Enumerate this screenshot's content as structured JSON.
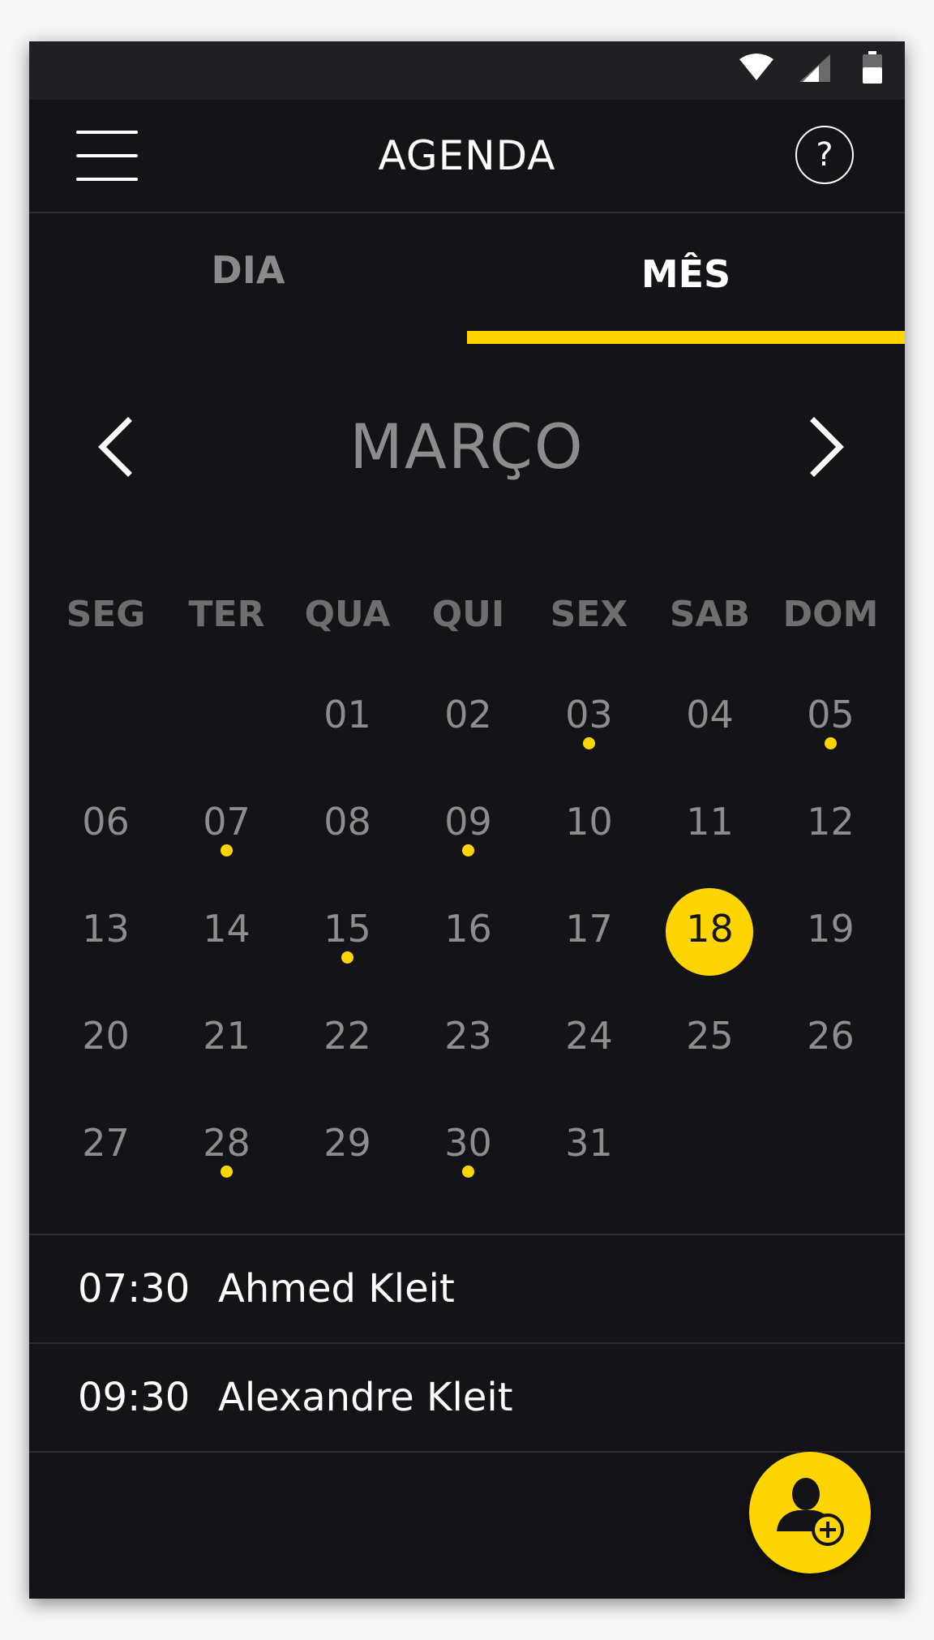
{
  "status_bar": {
    "icons": [
      "wifi-icon",
      "cell-signal-icon",
      "battery-icon"
    ]
  },
  "app_bar": {
    "title": "AGENDA",
    "menu_icon": "hamburger-menu-icon",
    "help_label": "?"
  },
  "tabs": [
    {
      "label": "DIA",
      "active": false
    },
    {
      "label": "MÊS",
      "active": true
    }
  ],
  "calendar": {
    "month": "MARÇO",
    "weekdays": [
      "SEG",
      "TER",
      "QUA",
      "QUI",
      "SEX",
      "SAB",
      "DOM"
    ],
    "days": [
      {
        "label": "01",
        "has_event": false
      },
      {
        "label": "02",
        "has_event": false
      },
      {
        "label": "03",
        "has_event": true
      },
      {
        "label": "04",
        "has_event": false
      },
      {
        "label": "05",
        "has_event": true
      },
      {
        "label": "06",
        "has_event": false
      },
      {
        "label": "07",
        "has_event": true
      },
      {
        "label": "08",
        "has_event": false
      },
      {
        "label": "09",
        "has_event": true
      },
      {
        "label": "10",
        "has_event": false
      },
      {
        "label": "11",
        "has_event": false
      },
      {
        "label": "12",
        "has_event": false
      },
      {
        "label": "13",
        "has_event": false
      },
      {
        "label": "14",
        "has_event": false
      },
      {
        "label": "15",
        "has_event": true
      },
      {
        "label": "16",
        "has_event": false
      },
      {
        "label": "17",
        "has_event": false
      },
      {
        "label": "18",
        "has_event": false,
        "selected": true
      },
      {
        "label": "19",
        "has_event": false
      },
      {
        "label": "20",
        "has_event": false
      },
      {
        "label": "21",
        "has_event": false
      },
      {
        "label": "22",
        "has_event": false
      },
      {
        "label": "23",
        "has_event": false
      },
      {
        "label": "24",
        "has_event": false
      },
      {
        "label": "25",
        "has_event": false
      },
      {
        "label": "26",
        "has_event": false
      },
      {
        "label": "27",
        "has_event": false
      },
      {
        "label": "28",
        "has_event": true
      },
      {
        "label": "29",
        "has_event": false
      },
      {
        "label": "30",
        "has_event": true
      },
      {
        "label": "31",
        "has_event": false
      }
    ]
  },
  "appointments": [
    {
      "time": "07:30",
      "name": "Ahmed Kleit"
    },
    {
      "time": "09:30",
      "name": "Alexandre Kleit"
    }
  ],
  "fab": {
    "icon": "add-person-icon"
  },
  "colors": {
    "background": "#141418",
    "accent": "#ffd500",
    "text_primary": "#ffffff",
    "text_muted": "#8d8d8d"
  }
}
